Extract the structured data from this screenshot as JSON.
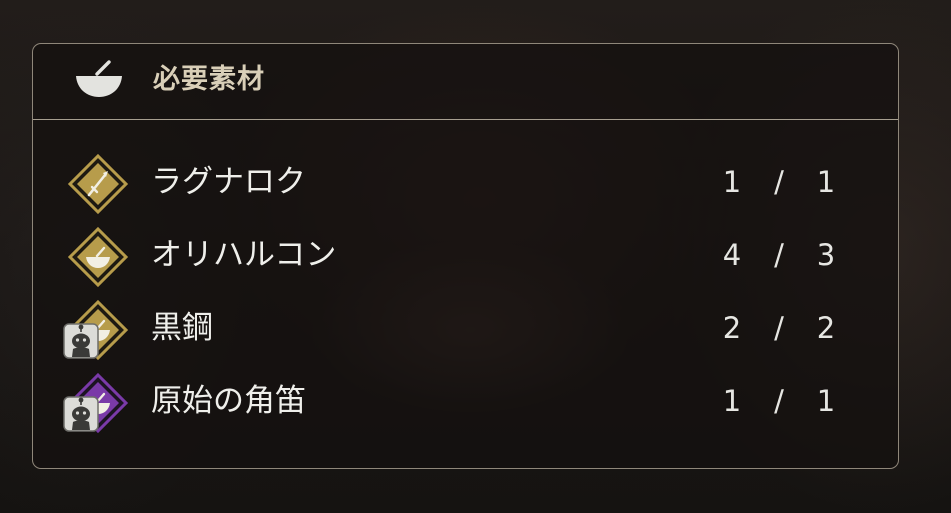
{
  "panel": {
    "title": "必要素材",
    "header_icon": "mortar-pestle-icon"
  },
  "items": [
    {
      "name": "ラグナロク",
      "have": "1",
      "separator": "/",
      "need": "1",
      "icon": "sword-icon",
      "icon_color": "#b79c4b",
      "badge": false
    },
    {
      "name": "オリハルコン",
      "have": "4",
      "separator": "/",
      "need": "3",
      "icon": "mortar-pestle-icon",
      "icon_color": "#b79c4b",
      "badge": false
    },
    {
      "name": "黒鋼",
      "have": "2",
      "separator": "/",
      "need": "2",
      "icon": "mortar-pestle-icon",
      "icon_color": "#b79c4b",
      "badge": true,
      "badge_icon": "moogle-icon"
    },
    {
      "name": "原始の角笛",
      "have": "1",
      "separator": "/",
      "need": "1",
      "icon": "mortar-pestle-icon",
      "icon_color": "#7a3aa8",
      "badge": true,
      "badge_icon": "moogle-icon"
    }
  ]
}
